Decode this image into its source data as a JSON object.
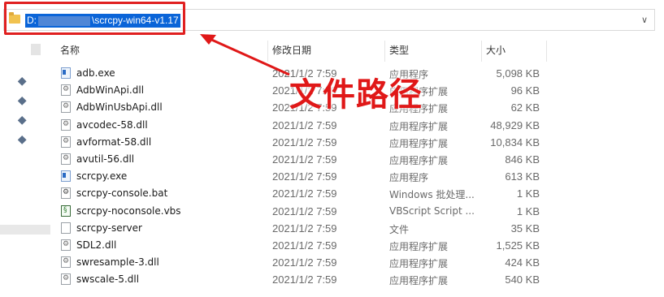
{
  "address_bar": {
    "path_prefix": "D:",
    "path_suffix": "\\scrcpy-win64-v1.17",
    "dropdown_icon": "chevron-down-icon"
  },
  "columns": {
    "name": "名称",
    "date": "修改日期",
    "type": "类型",
    "size": "大小"
  },
  "files": [
    {
      "name": "adb.exe",
      "date": "2021/1/2 7:59",
      "type": "应用程序",
      "size": "5,098 KB",
      "icon": "exe"
    },
    {
      "name": "AdbWinApi.dll",
      "date": "2021/1/2 7:59",
      "type": "应用程序扩展",
      "size": "96 KB",
      "icon": "dll"
    },
    {
      "name": "AdbWinUsbApi.dll",
      "date": "2021/1/2 7:59",
      "type": "应用程序扩展",
      "size": "62 KB",
      "icon": "dll"
    },
    {
      "name": "avcodec-58.dll",
      "date": "2021/1/2 7:59",
      "type": "应用程序扩展",
      "size": "48,929 KB",
      "icon": "dll"
    },
    {
      "name": "avformat-58.dll",
      "date": "2021/1/2 7:59",
      "type": "应用程序扩展",
      "size": "10,834 KB",
      "icon": "dll"
    },
    {
      "name": "avutil-56.dll",
      "date": "2021/1/2 7:59",
      "type": "应用程序扩展",
      "size": "846 KB",
      "icon": "dll"
    },
    {
      "name": "scrcpy.exe",
      "date": "2021/1/2 7:59",
      "type": "应用程序",
      "size": "613 KB",
      "icon": "exe"
    },
    {
      "name": "scrcpy-console.bat",
      "date": "2021/1/2 7:59",
      "type": "Windows 批处理...",
      "size": "1 KB",
      "icon": "bat"
    },
    {
      "name": "scrcpy-noconsole.vbs",
      "date": "2021/1/2 7:59",
      "type": "VBScript Script ...",
      "size": "1 KB",
      "icon": "vbs"
    },
    {
      "name": "scrcpy-server",
      "date": "2021/1/2 7:59",
      "type": "文件",
      "size": "35 KB",
      "icon": "file"
    },
    {
      "name": "SDL2.dll",
      "date": "2021/1/2 7:59",
      "type": "应用程序扩展",
      "size": "1,525 KB",
      "icon": "dll"
    },
    {
      "name": "swresample-3.dll",
      "date": "2021/1/2 7:59",
      "type": "应用程序扩展",
      "size": "424 KB",
      "icon": "dll"
    },
    {
      "name": "swscale-5.dll",
      "date": "2021/1/2 7:59",
      "type": "应用程序扩展",
      "size": "540 KB",
      "icon": "dll"
    }
  ],
  "annotation": {
    "text": "文件路径",
    "color": "#e01818"
  },
  "colors": {
    "selection": "#0a64d8",
    "highlight_box": "#e02020"
  }
}
